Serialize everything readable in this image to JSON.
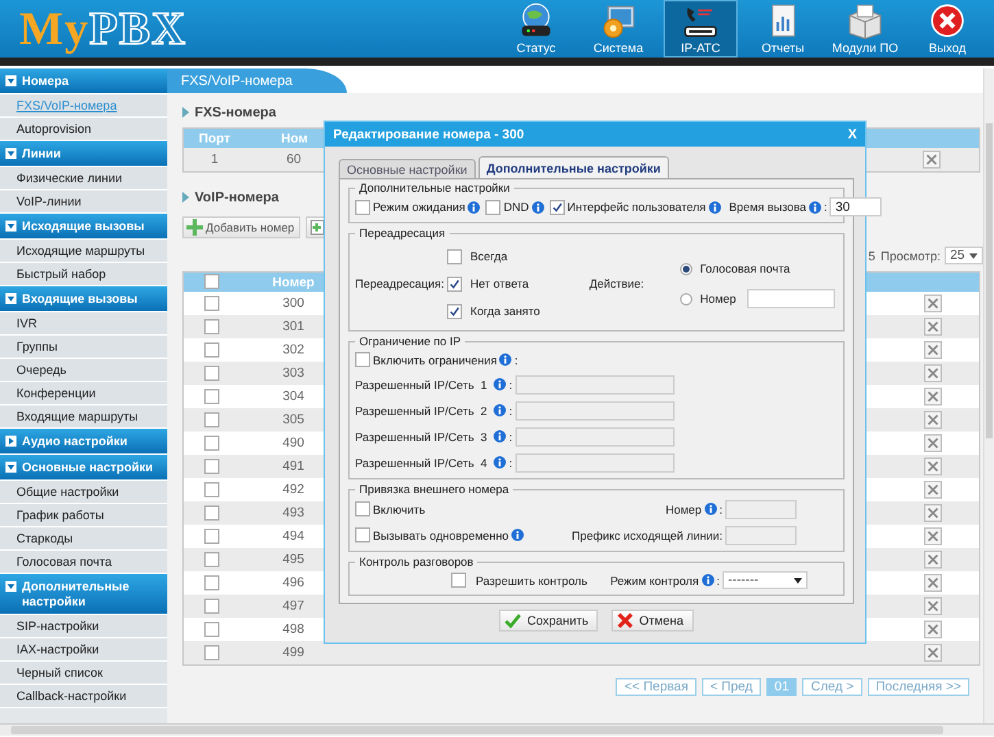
{
  "header": {
    "logo": [
      "My",
      "PBX"
    ],
    "nav": [
      {
        "label": "Статус",
        "kind": "status",
        "selected": false
      },
      {
        "label": "Система",
        "kind": "system",
        "selected": false
      },
      {
        "label": "IP-АТС",
        "kind": "pbx",
        "selected": true
      },
      {
        "label": "Отчеты",
        "kind": "reports",
        "selected": false
      },
      {
        "label": "Модули ПО",
        "kind": "modules",
        "selected": false
      },
      {
        "label": "Выход",
        "kind": "exit",
        "selected": false
      }
    ]
  },
  "sidebar": {
    "sections": [
      {
        "title": "Номера",
        "expanded": true,
        "items": [
          {
            "label": "FXS/VoIP-номера",
            "selected": true
          },
          {
            "label": "Autoprovision",
            "selected": false
          }
        ]
      },
      {
        "title": "Линии",
        "expanded": true,
        "items": [
          {
            "label": "Физические линии",
            "selected": false
          },
          {
            "label": "VoIP-линии",
            "selected": false
          }
        ]
      },
      {
        "title": "Исходящие вызовы",
        "expanded": true,
        "items": [
          {
            "label": "Исходящие маршруты",
            "selected": false
          },
          {
            "label": "Быстрый набор",
            "selected": false
          }
        ]
      },
      {
        "title": "Входящие вызовы",
        "expanded": true,
        "items": [
          {
            "label": "IVR",
            "selected": false
          },
          {
            "label": "Группы",
            "selected": false
          },
          {
            "label": "Очередь",
            "selected": false
          },
          {
            "label": "Конференции",
            "selected": false
          },
          {
            "label": "Входящие маршруты",
            "selected": false
          }
        ]
      },
      {
        "title": "Аудио настройки",
        "expanded": false
      },
      {
        "title": "Основные настройки",
        "expanded": true,
        "items": [
          {
            "label": "Общие настройки",
            "selected": false
          },
          {
            "label": "График работы",
            "selected": false
          },
          {
            "label": "Старкоды",
            "selected": false
          },
          {
            "label": "Голосовая почта",
            "selected": false
          }
        ]
      },
      {
        "title": "Дополнительные настройки",
        "expanded": true,
        "items": [
          {
            "label": "SIP-настройки",
            "selected": false
          },
          {
            "label": "IAX-настройки",
            "selected": false
          },
          {
            "label": "Черный список",
            "selected": false
          },
          {
            "label": "Callback-настройки",
            "selected": false
          }
        ]
      }
    ]
  },
  "content": {
    "title": "FXS/VoIP-номера",
    "fxs": {
      "heading": "FXS-номера",
      "columns": [
        "Порт",
        "Ном"
      ],
      "rows": [
        [
          "1",
          "60"
        ]
      ]
    },
    "voip": {
      "heading": "VoIP-номера",
      "add_button": "Добавить номер",
      "count_fragment": "5",
      "page_size_label": "Просмотр:",
      "page_size": "25",
      "header_checked": false,
      "columns": [
        "Номер"
      ],
      "rows": [
        {
          "number": "300",
          "checked": false
        },
        {
          "number": "301",
          "checked": false
        },
        {
          "number": "302",
          "checked": false
        },
        {
          "number": "303",
          "checked": false
        },
        {
          "number": "304",
          "checked": false
        },
        {
          "number": "305",
          "checked": false
        },
        {
          "number": "490",
          "checked": false
        },
        {
          "number": "491",
          "checked": false
        },
        {
          "number": "492",
          "checked": false
        },
        {
          "number": "493",
          "checked": false
        },
        {
          "number": "494",
          "checked": false
        },
        {
          "number": "495",
          "checked": false
        },
        {
          "number": "496",
          "checked": false
        },
        {
          "number": "497",
          "checked": false
        },
        {
          "number": "498",
          "checked": false
        },
        {
          "number": "499",
          "checked": false
        }
      ],
      "pagination": [
        {
          "label": "<< Первая",
          "selected": false
        },
        {
          "label": "< Пред",
          "selected": false
        },
        {
          "label": "01",
          "selected": true
        },
        {
          "label": "След >",
          "selected": false
        },
        {
          "label": "Последняя >>",
          "selected": false
        }
      ]
    }
  },
  "dialog": {
    "title": "Редактирование номера - 300",
    "close": "X",
    "tabs": [
      {
        "label": "Основные настройки",
        "selected": false
      },
      {
        "label": "Дополнительные настройки",
        "selected": true
      }
    ],
    "extra": {
      "legend": "Дополнительные настройки",
      "options": [
        {
          "label": "Режим ожидания",
          "checked": false
        },
        {
          "label": "DND",
          "checked": false
        },
        {
          "label": "Интерфейс пользователя",
          "checked": true
        }
      ],
      "call_time_label": "Время вызова",
      "colon": ":",
      "call_time": "30"
    },
    "forwarding": {
      "legend": "Переадресация",
      "label": "Переадресация:",
      "conditions": [
        {
          "label": "Всегда",
          "checked": false
        },
        {
          "label": "Нет ответа",
          "checked": true
        },
        {
          "label": "Когда занято",
          "checked": true
        }
      ],
      "action_label": "Действие:",
      "actions": [
        {
          "label": "Голосовая почта",
          "selected": true,
          "kind": "plain"
        },
        {
          "label": "Номер",
          "selected": false,
          "kind": "field"
        }
      ]
    },
    "ip": {
      "legend": "Ограничение по IP",
      "enable": {
        "label": "Включить ограничения",
        "checked": false
      },
      "colon": ":",
      "fields": [
        {
          "label": "Разрешенный IP/Сеть  1"
        },
        {
          "label": "Разрешенный IP/Сеть  2"
        },
        {
          "label": "Разрешенный IP/Сеть  3"
        },
        {
          "label": "Разрешенный IP/Сеть  4"
        }
      ]
    },
    "external": {
      "legend": "Привязка внешнего номера",
      "enable": {
        "label": "Включить",
        "checked": false
      },
      "simultaneous": {
        "label": "Вызывать одновременно",
        "checked": false
      },
      "number_label": "Номер",
      "colon": ":",
      "prefix_label": "Префикс исходящей линии:"
    },
    "monitor": {
      "legend": "Контроль разговоров",
      "allow": {
        "label": "Разрешить контроль",
        "checked": false
      },
      "mode_label": "Режим контроля",
      "colon": ":",
      "mode": "-------"
    },
    "buttons": [
      {
        "label": "Сохранить",
        "kind": "save"
      },
      {
        "label": "Отмена",
        "kind": "cancel"
      }
    ]
  }
}
